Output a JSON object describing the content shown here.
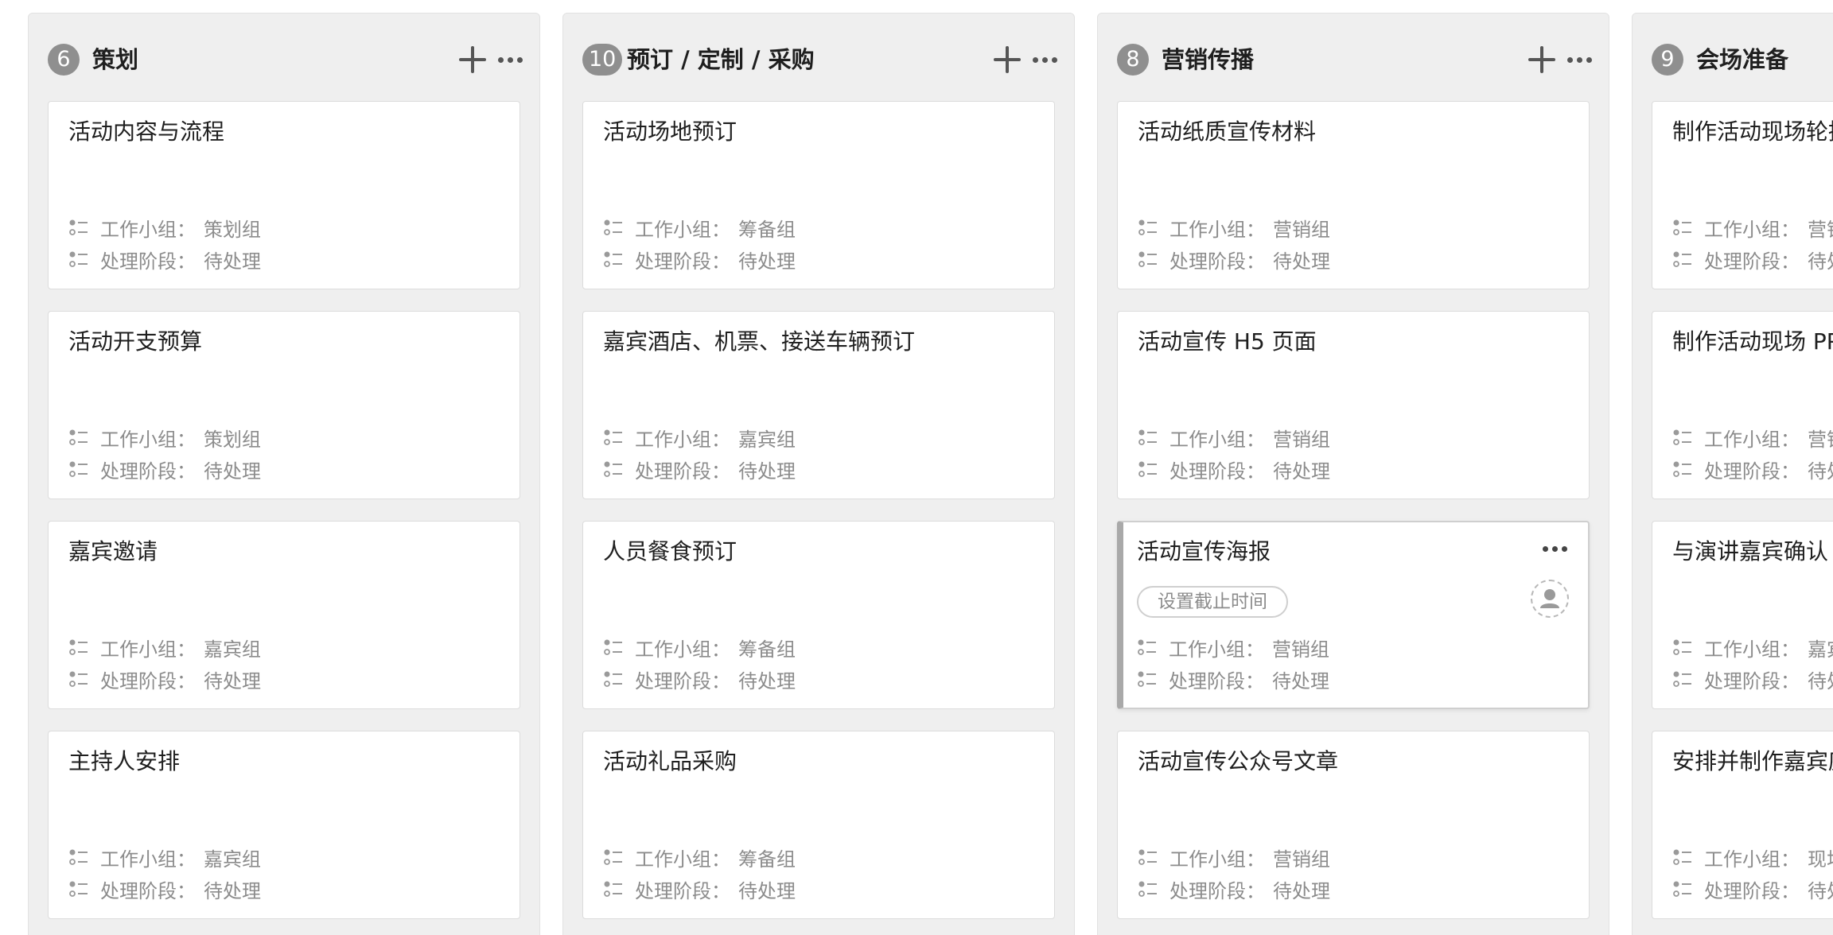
{
  "board": {
    "field_labels": {
      "group": "工作小组：",
      "stage": "处理阶段："
    },
    "columns": [
      {
        "count": "6",
        "title": "策划",
        "cards": [
          {
            "title": "活动内容与流程",
            "group": "策划组",
            "stage": "待处理"
          },
          {
            "title": "活动开支预算",
            "group": "策划组",
            "stage": "待处理"
          },
          {
            "title": "嘉宾邀请",
            "group": "嘉宾组",
            "stage": "待处理"
          },
          {
            "title": "主持人安排",
            "group": "嘉宾组",
            "stage": "待处理"
          }
        ]
      },
      {
        "count": "10",
        "title": "预订 / 定制 / 采购",
        "cards": [
          {
            "title": "活动场地预订",
            "group": "筹备组",
            "stage": "待处理"
          },
          {
            "title": "嘉宾酒店、机票、接送车辆预订",
            "group": "嘉宾组",
            "stage": "待处理"
          },
          {
            "title": "人员餐食预订",
            "group": "筹备组",
            "stage": "待处理"
          },
          {
            "title": "活动礼品采购",
            "group": "筹备组",
            "stage": "待处理"
          }
        ]
      },
      {
        "count": "8",
        "title": "营销传播",
        "cards": [
          {
            "title": "活动纸质宣传材料",
            "group": "营销组",
            "stage": "待处理"
          },
          {
            "title": "活动宣传 H5 页面",
            "group": "营销组",
            "stage": "待处理"
          },
          {
            "title": "活动宣传海报",
            "group": "营销组",
            "stage": "待处理",
            "deadline_label": "设置截止时间"
          },
          {
            "title": "活动宣传公众号文章",
            "group": "营销组",
            "stage": "待处理"
          }
        ]
      },
      {
        "count": "9",
        "title": "会场准备",
        "cards": [
          {
            "title": "制作活动现场轮播",
            "group": "营销组",
            "stage": "待处理"
          },
          {
            "title": "制作活动现场 PPT",
            "group": "营销组",
            "stage": "待处理"
          },
          {
            "title": "与演讲嘉宾确认",
            "group": "嘉宾组",
            "stage": "待处理"
          },
          {
            "title": "安排并制作嘉宾座位",
            "group": "现场组",
            "stage": "待处理"
          }
        ]
      }
    ]
  },
  "colors": {
    "column_bg": "#efefef",
    "card_bg": "#ffffff",
    "badge_bg": "#8f8f8f",
    "muted_text": "#8c8c8c"
  },
  "icons": {
    "add": "plus-icon",
    "more": "more-dots-icon",
    "field": "field-list-icon",
    "assignee": "user-avatar-icon"
  }
}
